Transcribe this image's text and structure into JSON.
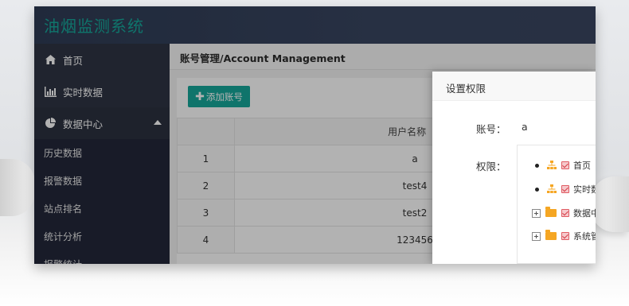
{
  "app": {
    "title": "油烟监测系统"
  },
  "sidebar": {
    "items": [
      {
        "label": "首页",
        "icon": "home-icon"
      },
      {
        "label": "实时数据",
        "icon": "bar-chart-icon"
      },
      {
        "label": "数据中心",
        "icon": "pie-chart-icon",
        "expanded": true
      }
    ],
    "sub_items": [
      "历史数据",
      "报警数据",
      "站点排名",
      "统计分析",
      "报警统计"
    ]
  },
  "main": {
    "breadcrumb": "账号管理/Account Management",
    "add_button": "添加账号",
    "table": {
      "columns": [
        "",
        "用户名称"
      ],
      "rows": [
        {
          "index": "1",
          "username": "a"
        },
        {
          "index": "2",
          "username": "test4"
        },
        {
          "index": "3",
          "username": "test2"
        },
        {
          "index": "4",
          "username": "123456"
        }
      ]
    }
  },
  "dialog": {
    "title": "设置权限",
    "account_label": "账号：",
    "account_value": "a",
    "permission_label": "权限：",
    "tree": [
      {
        "label": "首页",
        "type": "leaf",
        "checked": true
      },
      {
        "label": "实时数",
        "type": "leaf",
        "checked": true
      },
      {
        "label": "数据中",
        "type": "folder",
        "checked": true
      },
      {
        "label": "系统管",
        "type": "folder",
        "checked": true
      }
    ]
  },
  "colors": {
    "accent": "#16a79a",
    "topbar": "#2f3c55",
    "sidebar": "#2e3444",
    "checkbox": "#e05b63",
    "folder": "#f5a623"
  }
}
